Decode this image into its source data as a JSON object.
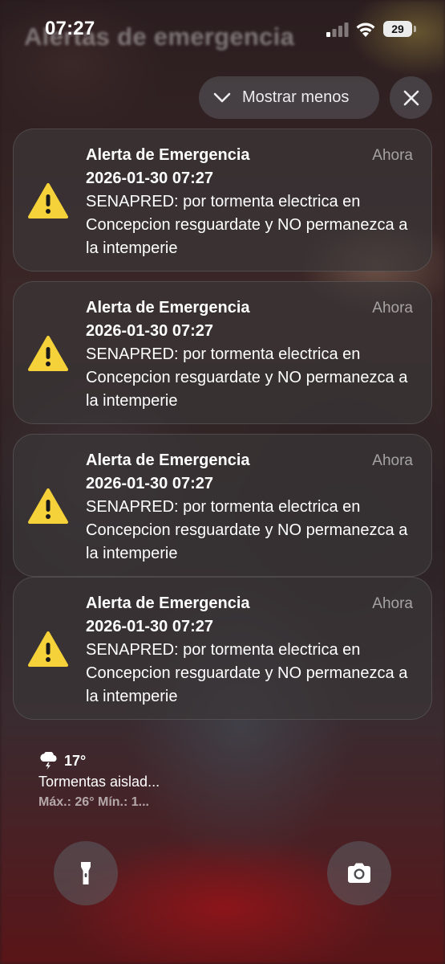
{
  "wallpaper_title": "Alertas de emergencia",
  "status_bar": {
    "time": "07:27",
    "battery": "29"
  },
  "controls": {
    "show_less_label": "Mostrar menos"
  },
  "notifications": [
    {
      "title": "Alerta de Emergencia",
      "date": "2026-01-30 07:27",
      "body": "SENAPRED: por tormenta electrica en Concepcion resguardate y NO permanezca a la intemperie",
      "time": "Ahora"
    },
    {
      "title": "Alerta de Emergencia",
      "date": "2026-01-30 07:27",
      "body": "SENAPRED: por tormenta electrica en Concepcion resguardate y NO permanezca a la intemperie",
      "time": "Ahora"
    },
    {
      "title": "Alerta de Emergencia",
      "date": "2026-01-30 07:27",
      "body": "SENAPRED: por tormenta electrica en Concepcion resguardate y NO permanezca a la intemperie",
      "time": "Ahora"
    },
    {
      "title": "Alerta de Emergencia",
      "date": "2026-01-30 07:27",
      "body": "SENAPRED: por tormenta electrica en Concepcion resguardate y NO permanezca a la intemperie",
      "time": "Ahora"
    }
  ],
  "weather": {
    "icon": "thunderstorm-icon",
    "temperature": "17°",
    "condition": "Tormentas aislad...",
    "range": "Máx.: 26° Mín.: 1..."
  },
  "quick_actions": {
    "left_icon": "flashlight-icon",
    "right_icon": "camera-icon"
  },
  "colors": {
    "warning_yellow": "#f6d23a",
    "card_background": "#3a3638"
  }
}
